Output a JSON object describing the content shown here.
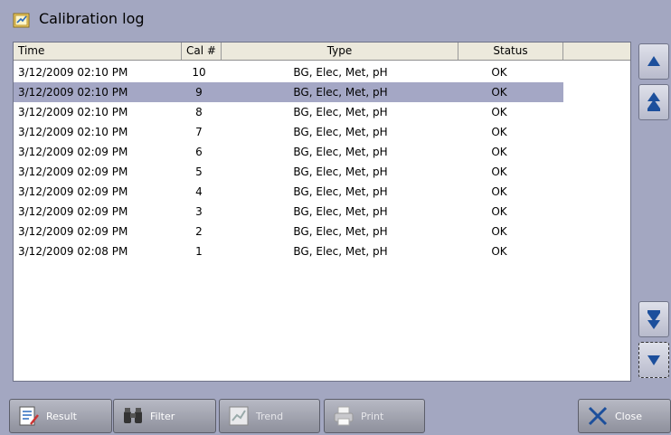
{
  "window": {
    "title": "Calibration log"
  },
  "table": {
    "columns": [
      "Time",
      "Cal #",
      "Type",
      "Status"
    ],
    "rows": [
      {
        "time": "3/12/2009 02:10 PM",
        "cal": "10",
        "type": "BG, Elec, Met, pH",
        "status": "OK"
      },
      {
        "time": "3/12/2009 02:10 PM",
        "cal": "9",
        "type": "BG, Elec, Met, pH",
        "status": "OK"
      },
      {
        "time": "3/12/2009 02:10 PM",
        "cal": "8",
        "type": "BG, Elec, Met, pH",
        "status": "OK"
      },
      {
        "time": "3/12/2009 02:10 PM",
        "cal": "7",
        "type": "BG, Elec, Met, pH",
        "status": "OK"
      },
      {
        "time": "3/12/2009 02:09 PM",
        "cal": "6",
        "type": "BG, Elec, Met, pH",
        "status": "OK"
      },
      {
        "time": "3/12/2009 02:09 PM",
        "cal": "5",
        "type": "BG, Elec, Met, pH",
        "status": "OK"
      },
      {
        "time": "3/12/2009 02:09 PM",
        "cal": "4",
        "type": "BG, Elec, Met, pH",
        "status": "OK"
      },
      {
        "time": "3/12/2009 02:09 PM",
        "cal": "3",
        "type": "BG, Elec, Met, pH",
        "status": "OK"
      },
      {
        "time": "3/12/2009 02:09 PM",
        "cal": "2",
        "type": "BG, Elec, Met, pH",
        "status": "OK"
      },
      {
        "time": "3/12/2009 02:08 PM",
        "cal": "1",
        "type": "BG, Elec, Met, pH",
        "status": "OK"
      }
    ],
    "selected_row_index": 1
  },
  "scroll_buttons": [
    {
      "icon": "scroll-up-icon"
    },
    {
      "icon": "page-up-icon"
    },
    {
      "icon": "page-down-icon"
    },
    {
      "icon": "scroll-down-icon"
    }
  ],
  "toolbar": {
    "result_label": "Result",
    "filter_label": "Filter",
    "trend_label": "Trend",
    "print_label": "Print",
    "close_label": "Close"
  },
  "colors": {
    "background": "#a3a7c1",
    "selected_row": "#a4a7c5",
    "arrow_blue": "#1c4f9c"
  }
}
